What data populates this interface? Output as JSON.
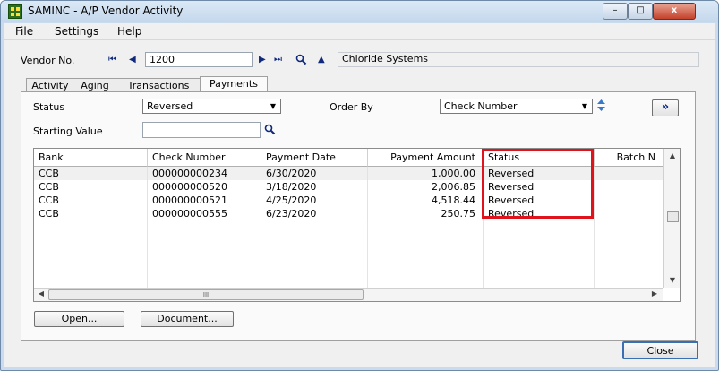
{
  "window": {
    "title": "SAMINC - A/P Vendor Activity"
  },
  "window_buttons": {
    "minimize": "–",
    "maximize": "□",
    "close": "x"
  },
  "menu": [
    "File",
    "Settings",
    "Help"
  ],
  "vendor": {
    "label": "Vendor No.",
    "number": "1200",
    "name": "Chloride Systems",
    "nav_first": "⏮",
    "nav_prev": "◀",
    "nav_next": "▶",
    "nav_last": "⏭",
    "finder_icon": "magnifier",
    "zoom_icon": "▲"
  },
  "tabs": [
    {
      "label": "Activity",
      "active": false
    },
    {
      "label": "Aging",
      "active": false
    },
    {
      "label": "Transactions",
      "active": false
    },
    {
      "label": "Payments",
      "active": true
    }
  ],
  "filters": {
    "status_label": "Status",
    "status_value": "Reversed",
    "order_by_label": "Order By",
    "order_by_value": "Check Number",
    "starting_value_label": "Starting Value",
    "starting_value": "",
    "go_button": "»"
  },
  "grid": {
    "columns": [
      "Bank",
      "Check Number",
      "Payment Date",
      "Payment Amount",
      "Status",
      "Batch N"
    ],
    "rows": [
      [
        "CCB",
        "000000000234",
        "6/30/2020",
        "1,000.00",
        "Reversed",
        ""
      ],
      [
        "CCB",
        "000000000520",
        "3/18/2020",
        "2,006.85",
        "Reversed",
        ""
      ],
      [
        "CCB",
        "000000000521",
        "4/25/2020",
        "4,518.44",
        "Reversed",
        ""
      ],
      [
        "CCB",
        "000000000555",
        "6/23/2020",
        "250.75",
        "Reversed",
        ""
      ]
    ],
    "hscroll_thumb": "III"
  },
  "buttons": {
    "open": "Open...",
    "document": "Document...",
    "close": "Close"
  },
  "colors": {
    "highlight": "#e0121b",
    "window_frame": "#c9dbed"
  }
}
